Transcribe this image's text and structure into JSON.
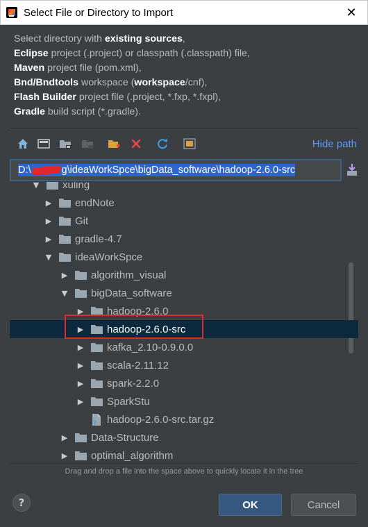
{
  "window": {
    "title": "Select File or Directory to Import",
    "close": "✕"
  },
  "description": [
    [
      {
        "t": "Select directory with ",
        "b": false
      },
      {
        "t": "existing sources",
        "b": true
      },
      {
        "t": ",",
        "b": false
      }
    ],
    [
      {
        "t": "Eclipse",
        "b": true
      },
      {
        "t": " project (.project) or classpath (.classpath) file,",
        "b": false
      }
    ],
    [
      {
        "t": "Maven",
        "b": true
      },
      {
        "t": " project file (pom.xml),",
        "b": false
      }
    ],
    [
      {
        "t": "Bnd/Bndtools",
        "b": true
      },
      {
        "t": " workspace (",
        "b": false
      },
      {
        "t": "workspace",
        "b": true
      },
      {
        "t": "/cnf),",
        "b": false
      }
    ],
    [
      {
        "t": "Flash Builder",
        "b": true
      },
      {
        "t": " project file (.project, *.fxp, *.fxpl),",
        "b": false
      }
    ],
    [
      {
        "t": "Gradle",
        "b": true
      },
      {
        "t": " build script (*.gradle).",
        "b": false
      }
    ]
  ],
  "toolbar": {
    "hide_path": "Hide path",
    "icons": [
      "home-icon",
      "desktop-icon",
      "project-icon",
      "module-icon",
      "new-folder-icon",
      "delete-icon",
      "refresh-icon",
      "show-hidden-icon"
    ]
  },
  "path": {
    "prefix": "D:\\",
    "suffix": "g\\ideaWorkSpce\\bigData_software\\hadoop-2.6.0-src"
  },
  "tree": [
    {
      "label": "xuling",
      "level": 1,
      "expanded": true,
      "type": "folder"
    },
    {
      "label": "endNote",
      "level": 2,
      "expanded": false,
      "type": "folder"
    },
    {
      "label": "Git",
      "level": 2,
      "expanded": false,
      "type": "folder"
    },
    {
      "label": "gradle-4.7",
      "level": 2,
      "expanded": false,
      "type": "folder"
    },
    {
      "label": "ideaWorkSpce",
      "level": 2,
      "expanded": true,
      "type": "folder"
    },
    {
      "label": "algorithm_visual",
      "level": 3,
      "expanded": false,
      "type": "folder"
    },
    {
      "label": "bigData_software",
      "level": 3,
      "expanded": true,
      "type": "folder"
    },
    {
      "label": "hadoop-2.6.0",
      "level": 4,
      "expanded": false,
      "type": "folder"
    },
    {
      "label": "hadoop-2.6.0-src",
      "level": 4,
      "expanded": false,
      "type": "folder",
      "selected": true
    },
    {
      "label": "kafka_2.10-0.9.0.0",
      "level": 4,
      "expanded": false,
      "type": "folder"
    },
    {
      "label": "scala-2.11.12",
      "level": 4,
      "expanded": false,
      "type": "folder"
    },
    {
      "label": "spark-2.2.0",
      "level": 4,
      "expanded": false,
      "type": "folder"
    },
    {
      "label": "SparkStu",
      "level": 4,
      "expanded": false,
      "type": "folder"
    },
    {
      "label": "hadoop-2.6.0-src.tar.gz",
      "level": 4,
      "expanded": null,
      "type": "file"
    },
    {
      "label": "Data-Structure",
      "level": 3,
      "expanded": false,
      "type": "folder"
    },
    {
      "label": "optimal_algorithm",
      "level": 3,
      "expanded": false,
      "type": "folder"
    }
  ],
  "hint": "Drag and drop a file into the space above to quickly locate it in the tree",
  "buttons": {
    "help": "?",
    "ok": "OK",
    "cancel": "Cancel"
  },
  "colors": {
    "background": "#3c3f41",
    "selection": "#0d293e",
    "accent": "#589df6",
    "ok_button": "#365880",
    "highlight_box": "#e1282c"
  }
}
